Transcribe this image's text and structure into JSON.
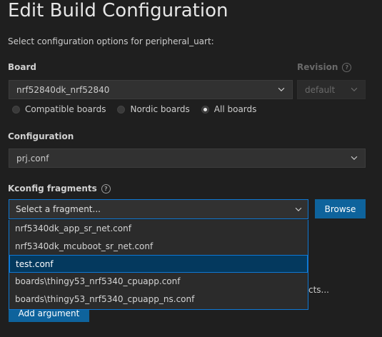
{
  "page": {
    "title": "Edit Build Configuration",
    "description": "Select configuration options for peripheral_uart:"
  },
  "board": {
    "label": "Board",
    "value": "nrf52840dk_nrf52840"
  },
  "revision": {
    "label": "Revision",
    "value": "default"
  },
  "board_filter": {
    "options": [
      "Compatible boards",
      "Nordic boards",
      "All boards"
    ],
    "selected": "All boards"
  },
  "configuration": {
    "label": "Configuration",
    "value": "prj.conf"
  },
  "kconfig": {
    "label": "Kconfig fragments",
    "placeholder": "Select a fragment...",
    "browse_label": "Browse",
    "dropdown_items": [
      "nrf5340dk_app_sr_net.conf",
      "nrf5340dk_mcuboot_sr_net.conf",
      "test.conf",
      "boards\\thingy53_nrf5340_cpuapp.conf",
      "boards\\thingy53_nrf5340_cpuapp_ns.conf"
    ],
    "highlighted_item": "test.conf"
  },
  "obscured": {
    "partial_text": "cts..."
  },
  "extra_args": {
    "add_label": "Add argument"
  },
  "colors": {
    "background": "#1f1f1f",
    "accent": "#0e78d4",
    "button": "#0e639c",
    "selected_item": "#04395e"
  }
}
